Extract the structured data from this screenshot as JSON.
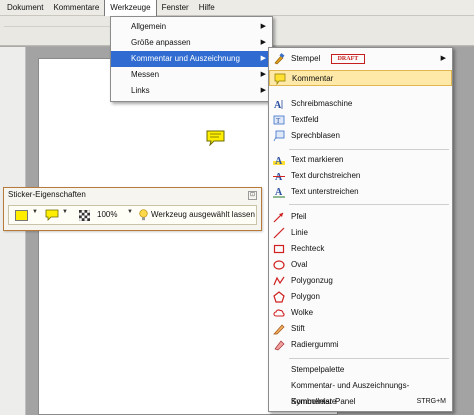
{
  "menubar": {
    "items": [
      "Dokument",
      "Kommentare",
      "Werkzeuge",
      "Fenster",
      "Hilfe"
    ]
  },
  "werkzeuge_menu": {
    "items": [
      {
        "label": "Allgemein",
        "submenu": true
      },
      {
        "label": "Größe anpassen",
        "submenu": true
      },
      {
        "label": "Kommentar und Auszeichnung",
        "submenu": true,
        "highlighted": true
      },
      {
        "label": "Messen",
        "submenu": true
      },
      {
        "label": "Links",
        "submenu": true
      }
    ]
  },
  "kommentar_menu": {
    "stempel": {
      "label": "Stempel",
      "badge": "DRAFT"
    },
    "kommentar": "Kommentar",
    "group1": [
      "Schreibmaschine",
      "Textfeld",
      "Sprechblasen"
    ],
    "group2": [
      "Text markieren",
      "Text durchstreichen",
      "Text unterstreichen"
    ],
    "group3": [
      "Pfeil",
      "Linie",
      "Rechteck",
      "Oval",
      "Polygonzug",
      "Polygon",
      "Wolke",
      "Stift",
      "Radiergummi"
    ],
    "group4": [
      "Stempelpalette",
      "Kommentar- und Auszeichnungs-Symbolleiste",
      "Kommentar-Panel"
    ],
    "shortcut": "STRG+M"
  },
  "sticker_panel": {
    "title": "Sticker-Eigenschaften",
    "opacity": "100%",
    "keep_tool_label": "Werkzeug ausgewählt lassen"
  },
  "colors": {
    "highlight_blue": "#2f6bd0",
    "hover_yellow": "#ffe9a8",
    "note_yellow": "#ffee00",
    "stamp_red": "#c61e1e"
  }
}
